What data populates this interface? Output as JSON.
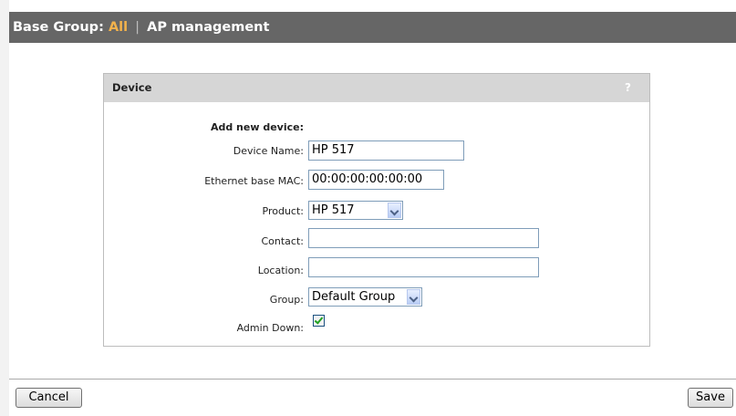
{
  "header": {
    "prefix": "Base Group:",
    "group": "All",
    "separator": "|",
    "section": "AP management"
  },
  "panel": {
    "title": "Device",
    "help": "?",
    "form_heading": "Add new device:",
    "fields": {
      "device_name": {
        "label": "Device Name:",
        "value": "HP 517"
      },
      "ethernet_mac": {
        "label": "Ethernet base MAC:",
        "value": "00:00:00:00:00:00"
      },
      "product": {
        "label": "Product:",
        "value": "HP 517"
      },
      "contact": {
        "label": "Contact:",
        "value": ""
      },
      "location": {
        "label": "Location:",
        "value": ""
      },
      "group": {
        "label": "Group:",
        "value": "Default Group"
      },
      "admin_down": {
        "label": "Admin Down:",
        "checked": true
      }
    }
  },
  "buttons": {
    "cancel": "Cancel",
    "save": "Save"
  },
  "colors": {
    "header_bg": "#666666",
    "accent": "#f2b24c",
    "panel_header_bg": "#d6d6d6"
  }
}
